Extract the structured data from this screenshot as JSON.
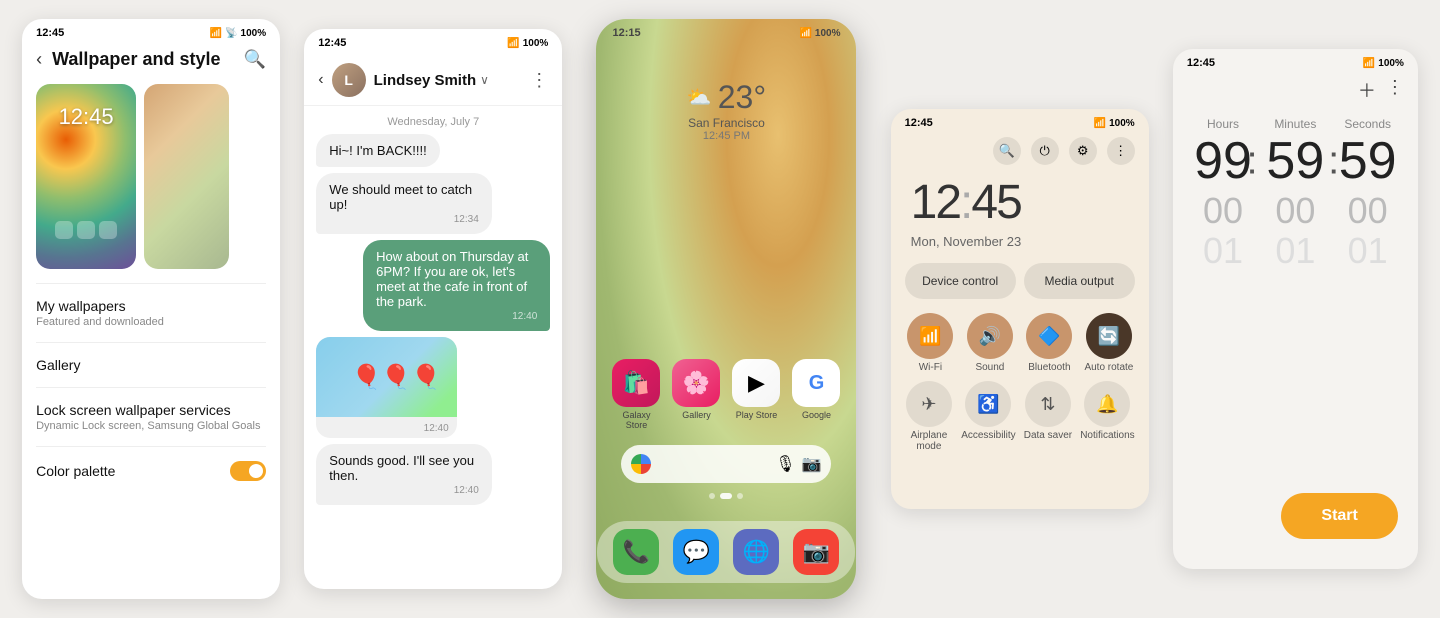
{
  "panel_wallpaper": {
    "statusbar_time": "12:45",
    "title": "Wallpaper and style",
    "battery": "100%",
    "menu_items": [
      {
        "label": "My wallpapers",
        "sub": "Featured and downloaded"
      },
      {
        "label": "Gallery"
      },
      {
        "label": "Lock screen wallpaper services",
        "sub": "Dynamic Lock screen, Samsung Global Goals"
      },
      {
        "label": "Color palette"
      }
    ]
  },
  "panel_messaging": {
    "statusbar_time": "12:45",
    "battery": "100%",
    "contact_name": "Lindsey Smith",
    "date_label": "Wednesday, July 7",
    "messages": [
      {
        "type": "received",
        "text": "Hi~! I'm BACK!!!!",
        "time": ""
      },
      {
        "type": "received",
        "text": "We should meet to catch up!",
        "time": "12:34"
      },
      {
        "type": "sent",
        "text": "How about on Thursday at 6PM? If you are ok, let's meet at the cafe in front of the park.",
        "time": "12:40"
      },
      {
        "type": "image",
        "time": "12:40"
      },
      {
        "type": "received",
        "text": "Sounds good. I'll see you then.",
        "time": "12:40"
      }
    ]
  },
  "panel_home": {
    "statusbar_time": "12:15",
    "battery": "100%",
    "weather_temp": "23°",
    "weather_city": "San Francisco",
    "weather_time": "12:45 PM",
    "apps": [
      {
        "label": "Galaxy Store",
        "emoji": "🛍️"
      },
      {
        "label": "Gallery",
        "emoji": "🌸"
      },
      {
        "label": "Play Store",
        "emoji": "▶️"
      },
      {
        "label": "Google",
        "emoji": "G"
      }
    ],
    "dock_apps": [
      {
        "label": "Phone",
        "emoji": "📞"
      },
      {
        "label": "Messages",
        "emoji": "💬"
      },
      {
        "label": "Browser",
        "emoji": "🌐"
      },
      {
        "label": "Camera",
        "emoji": "📷"
      }
    ]
  },
  "panel_quick": {
    "statusbar_time": "12:45",
    "battery": "100%",
    "clock": "12",
    "clock_min": "45",
    "date": "Mon, November 23",
    "device_control": "Device control",
    "media_output": "Media output",
    "tiles": [
      {
        "label": "Wi-Fi",
        "icon": "📶",
        "active": true
      },
      {
        "label": "Sound",
        "icon": "🔊",
        "active": true
      },
      {
        "label": "Bluetooth",
        "icon": "🔵",
        "active": true
      },
      {
        "label": "Auto rotate",
        "icon": "🔄",
        "active": false
      }
    ],
    "tiles_row2": [
      {
        "label": "Airplane mode",
        "icon": "✈️",
        "active": false
      },
      {
        "label": "Accessibility",
        "icon": "♿",
        "active": false
      },
      {
        "label": "Data saver",
        "icon": "⇅",
        "active": false
      },
      {
        "label": "Notifications",
        "icon": "🔔",
        "active": false
      }
    ]
  },
  "panel_timer": {
    "statusbar_time": "12:45",
    "battery": "100%",
    "labels": [
      "Hours",
      "Minutes",
      "Seconds"
    ],
    "main_values": [
      "99",
      "59",
      "59"
    ],
    "colons_main": [
      ":",
      ":"
    ],
    "sub_values": [
      "00",
      "00",
      "00"
    ],
    "colons_sub": [
      ":",
      ":"
    ],
    "sub_sub_values": [
      "01",
      "01",
      "01"
    ],
    "start_label": "Start"
  }
}
